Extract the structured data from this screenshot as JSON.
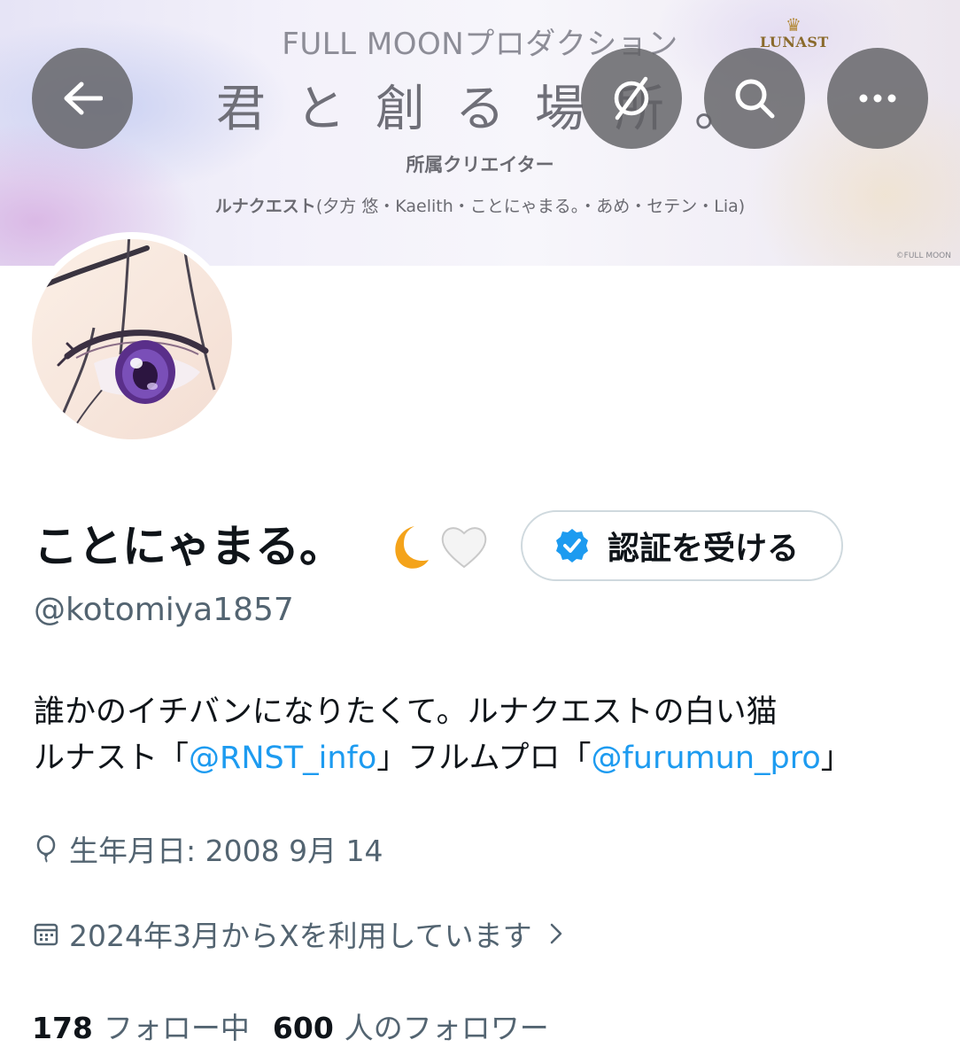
{
  "banner": {
    "brand": "FULL MOONプロダクション",
    "tagline": "君と創る場所。",
    "subtitle": "所属クリエイター",
    "members_group": "ルナクエスト",
    "members_list": "(夕方 悠・Kaelith・ことにゃまる。・あめ・セテン・Lia)",
    "logo_text": "LUNAST",
    "copyright": "©FULL MOON"
  },
  "toolbar": {
    "back_icon": "arrow-left-icon",
    "mute_icon": "muted-icon",
    "search_icon": "search-icon",
    "more_icon": "more-horizontal-icon"
  },
  "profile": {
    "display_name": "ことにゃまる。",
    "name_emojis": [
      "crescent-moon",
      "white-heart"
    ],
    "verify_label": "認証を受ける",
    "handle": "@kotomiya1857",
    "bio_line1": "誰かのイチバンになりたくて。ルナクエストの白い猫",
    "bio_line2_prefix": "ルナスト「",
    "bio_mention1": "@RNST_info",
    "bio_line2_middle": "」フルムプロ「",
    "bio_mention2": "@furumun_pro",
    "bio_line2_suffix": "」",
    "birthday": "生年月日: 2008 9月 14",
    "joined": "2024年3月からXを利用しています",
    "following_count": "178",
    "following_label": "フォロー中",
    "followers_count": "600",
    "followers_label": "人のフォロワー"
  },
  "colors": {
    "accent": "#1d9bf0",
    "text_primary": "#0f1419",
    "text_secondary": "#536471",
    "border": "#cfd9de"
  }
}
